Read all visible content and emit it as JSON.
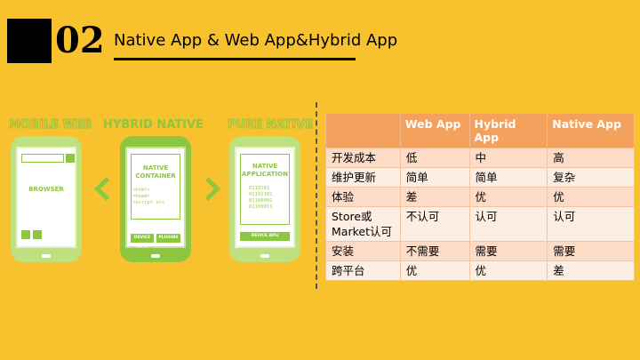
{
  "header": {
    "number": "02",
    "title": "Native App & Web App&Hybrid App"
  },
  "diagram": {
    "columns": [
      {
        "title": "MOBILE WEB",
        "screen_label": "BROWSER"
      },
      {
        "title": "HYBRID NATIVE",
        "screen_label": "NATIVE CONTAINER",
        "code": [
          "<html>",
          "<head>",
          "<script src"
        ],
        "buttons": [
          "DEVICE APIs",
          "PLUGINS"
        ]
      },
      {
        "title": "PURE NATIVE",
        "screen_label": "NATIVE APPLICATION",
        "code": [
          "0110101",
          "01101101",
          "01100001",
          "01100011"
        ],
        "buttons": [
          "DEVICE APIs"
        ]
      }
    ]
  },
  "table": {
    "headers": [
      "",
      "Web App",
      "Hybrid App",
      "Native App"
    ],
    "rows": [
      [
        "开发成本",
        "低",
        "中",
        "高"
      ],
      [
        "维护更新",
        "简单",
        "简单",
        "复杂"
      ],
      [
        "体验",
        "差",
        "优",
        "优"
      ],
      [
        "Store或Market认可",
        "不认可",
        "认可",
        "认可"
      ],
      [
        "安装",
        "不需要",
        "需要",
        "需要"
      ],
      [
        "跨平台",
        "优",
        "优",
        "差"
      ]
    ]
  },
  "colors": {
    "background": "#f8c12e",
    "green": "#8dc63f",
    "table_header": "#f5a15e"
  }
}
